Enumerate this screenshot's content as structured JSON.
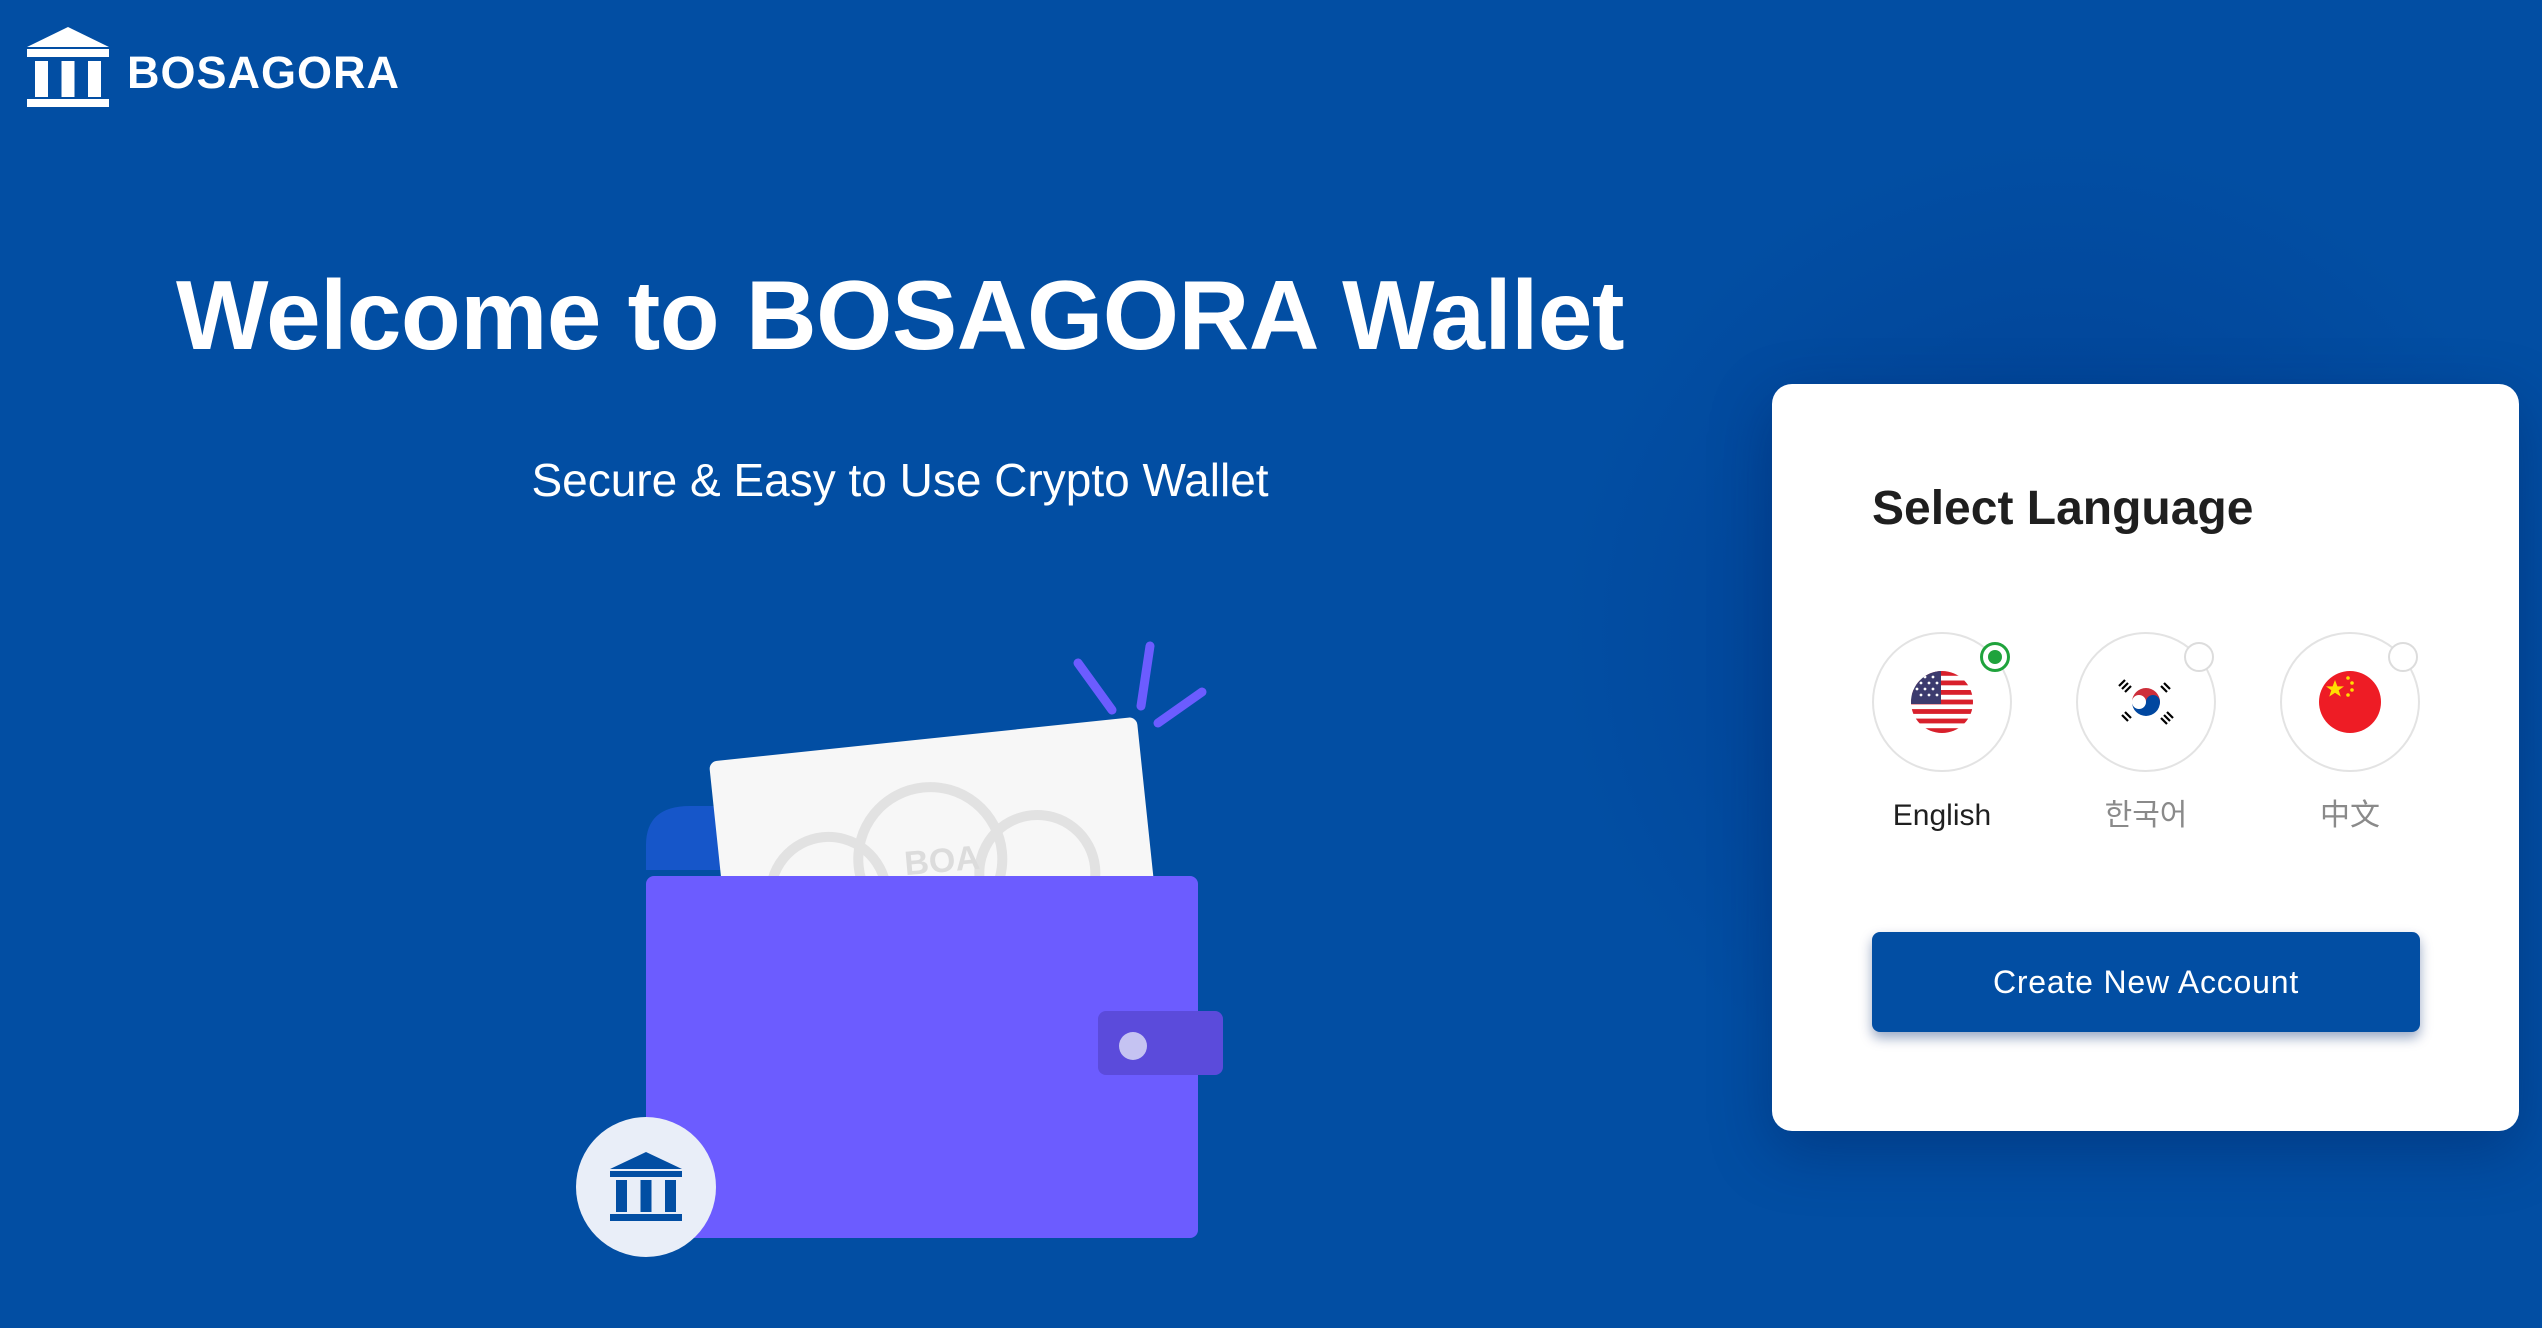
{
  "brand": {
    "name": "BOSAGORA",
    "logo_icon": "bank-building-icon"
  },
  "hero": {
    "title": "Welcome to BOSAGORA Wallet",
    "subtitle": "Secure & Easy to Use Crypto Wallet",
    "illustration": {
      "coin_label": "BOA",
      "badge_icon": "bank-building-icon"
    }
  },
  "language_card": {
    "title": "Select Language",
    "options": [
      {
        "label": "English",
        "flag": "us-flag-icon",
        "selected": true
      },
      {
        "label": "한국어",
        "flag": "kr-flag-icon",
        "selected": false
      },
      {
        "label": "中文",
        "flag": "cn-flag-icon",
        "selected": false
      }
    ],
    "create_button_label": "Create New Account"
  },
  "colors": {
    "background": "#024ea3",
    "wallet": "#6c5cff",
    "button": "#024ea3",
    "selected_radio": "#1fa33c"
  }
}
